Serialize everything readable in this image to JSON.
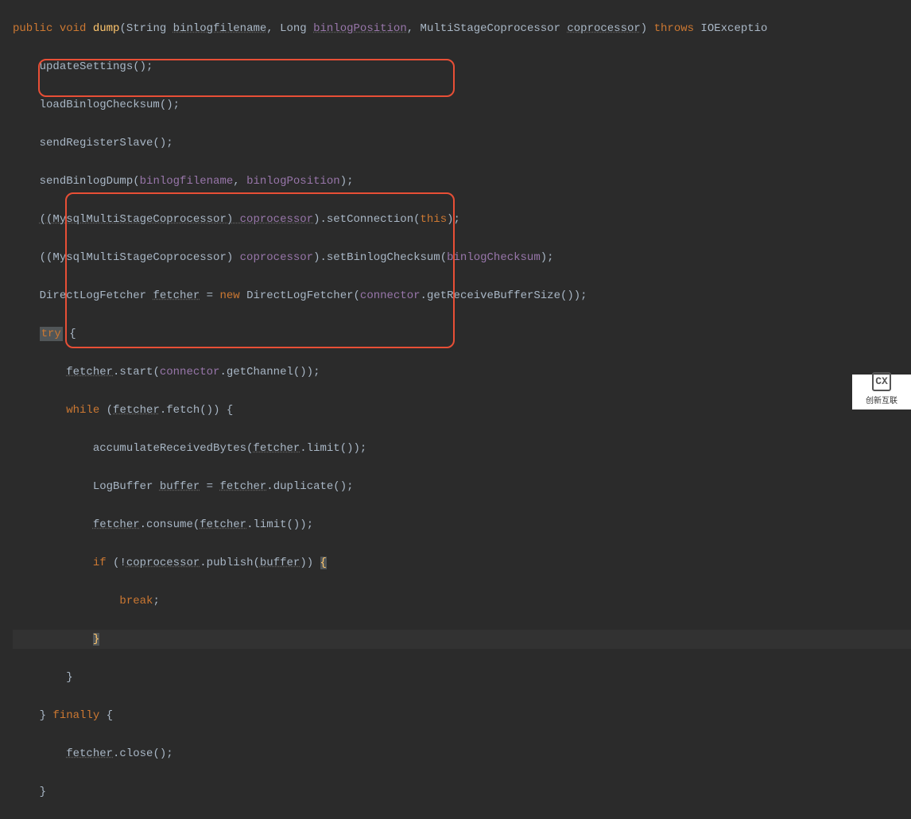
{
  "code": {
    "l1_public": "public",
    "l1_void": "void",
    "l1_method": "dump",
    "l1_p1": "(String ",
    "l1_param1": "binlogfilename",
    "l1_p2": ", Long ",
    "l1_param2": "binlogPosition",
    "l1_p3": ", MultiStageCoprocessor ",
    "l1_param3": "coprocessor",
    "l1_p4": ") ",
    "l1_throws": "throws",
    "l1_ex": " IOExceptio",
    "l2": "updateSettings();",
    "l3": "loadBinlogChecksum();",
    "l4": "sendRegisterSlave();",
    "l5a": "sendBinlogDump(",
    "l5b": "binlogfilename",
    "l5c": ", ",
    "l5d": "binlogPosition",
    "l5e": ");",
    "l6a": "((MysqlMultiStageCoprocessor) ",
    "l6b": "coprocessor",
    "l6c": ").setConnection(",
    "l6d": "this",
    "l6e": ");",
    "l7a": "((MysqlMultiStageCoprocessor) ",
    "l7b": "coprocessor",
    "l7c": ").setBinlogChecksum(",
    "l7d": "binlogChecksum",
    "l7e": ");",
    "l8a": "DirectLogFetcher ",
    "l8b": "fetcher",
    "l8c": " = ",
    "l8d": "new",
    "l8e": " DirectLogFetcher(",
    "l8f": "connector",
    "l8g": ".getReceiveBufferSize());",
    "l9a": "try",
    "l9b": " {",
    "l10a": "fetcher",
    "l10b": ".start(",
    "l10c": "connector",
    "l10d": ".getChannel());",
    "l11a": "while",
    "l11b": " (",
    "l11c": "fetcher",
    "l11d": ".fetch()) {",
    "l12a": "accumulateReceivedBytes(",
    "l12b": "fetcher",
    "l12c": ".limit());",
    "l13a": "LogBuffer ",
    "l13b": "buffer",
    "l13c": " = ",
    "l13d": "fetcher",
    "l13e": ".duplicate();",
    "l14a": "fetcher",
    "l14b": ".consume(",
    "l14c": "fetcher",
    "l14d": ".limit());",
    "l15a": "if",
    "l15b": " (!",
    "l15c": "coprocessor",
    "l15d": ".publish(",
    "l15e": "buffer",
    "l15f": ")) ",
    "l15g": "{",
    "l16a": "break",
    "l16b": ";",
    "l17": "}",
    "l18": "}",
    "l19a": "} ",
    "l19b": "finally",
    "l19c": " {",
    "l20a": "fetcher",
    "l20b": ".close();",
    "l21": "}"
  },
  "logo": {
    "text": "创新互联",
    "icon": "CX"
  }
}
